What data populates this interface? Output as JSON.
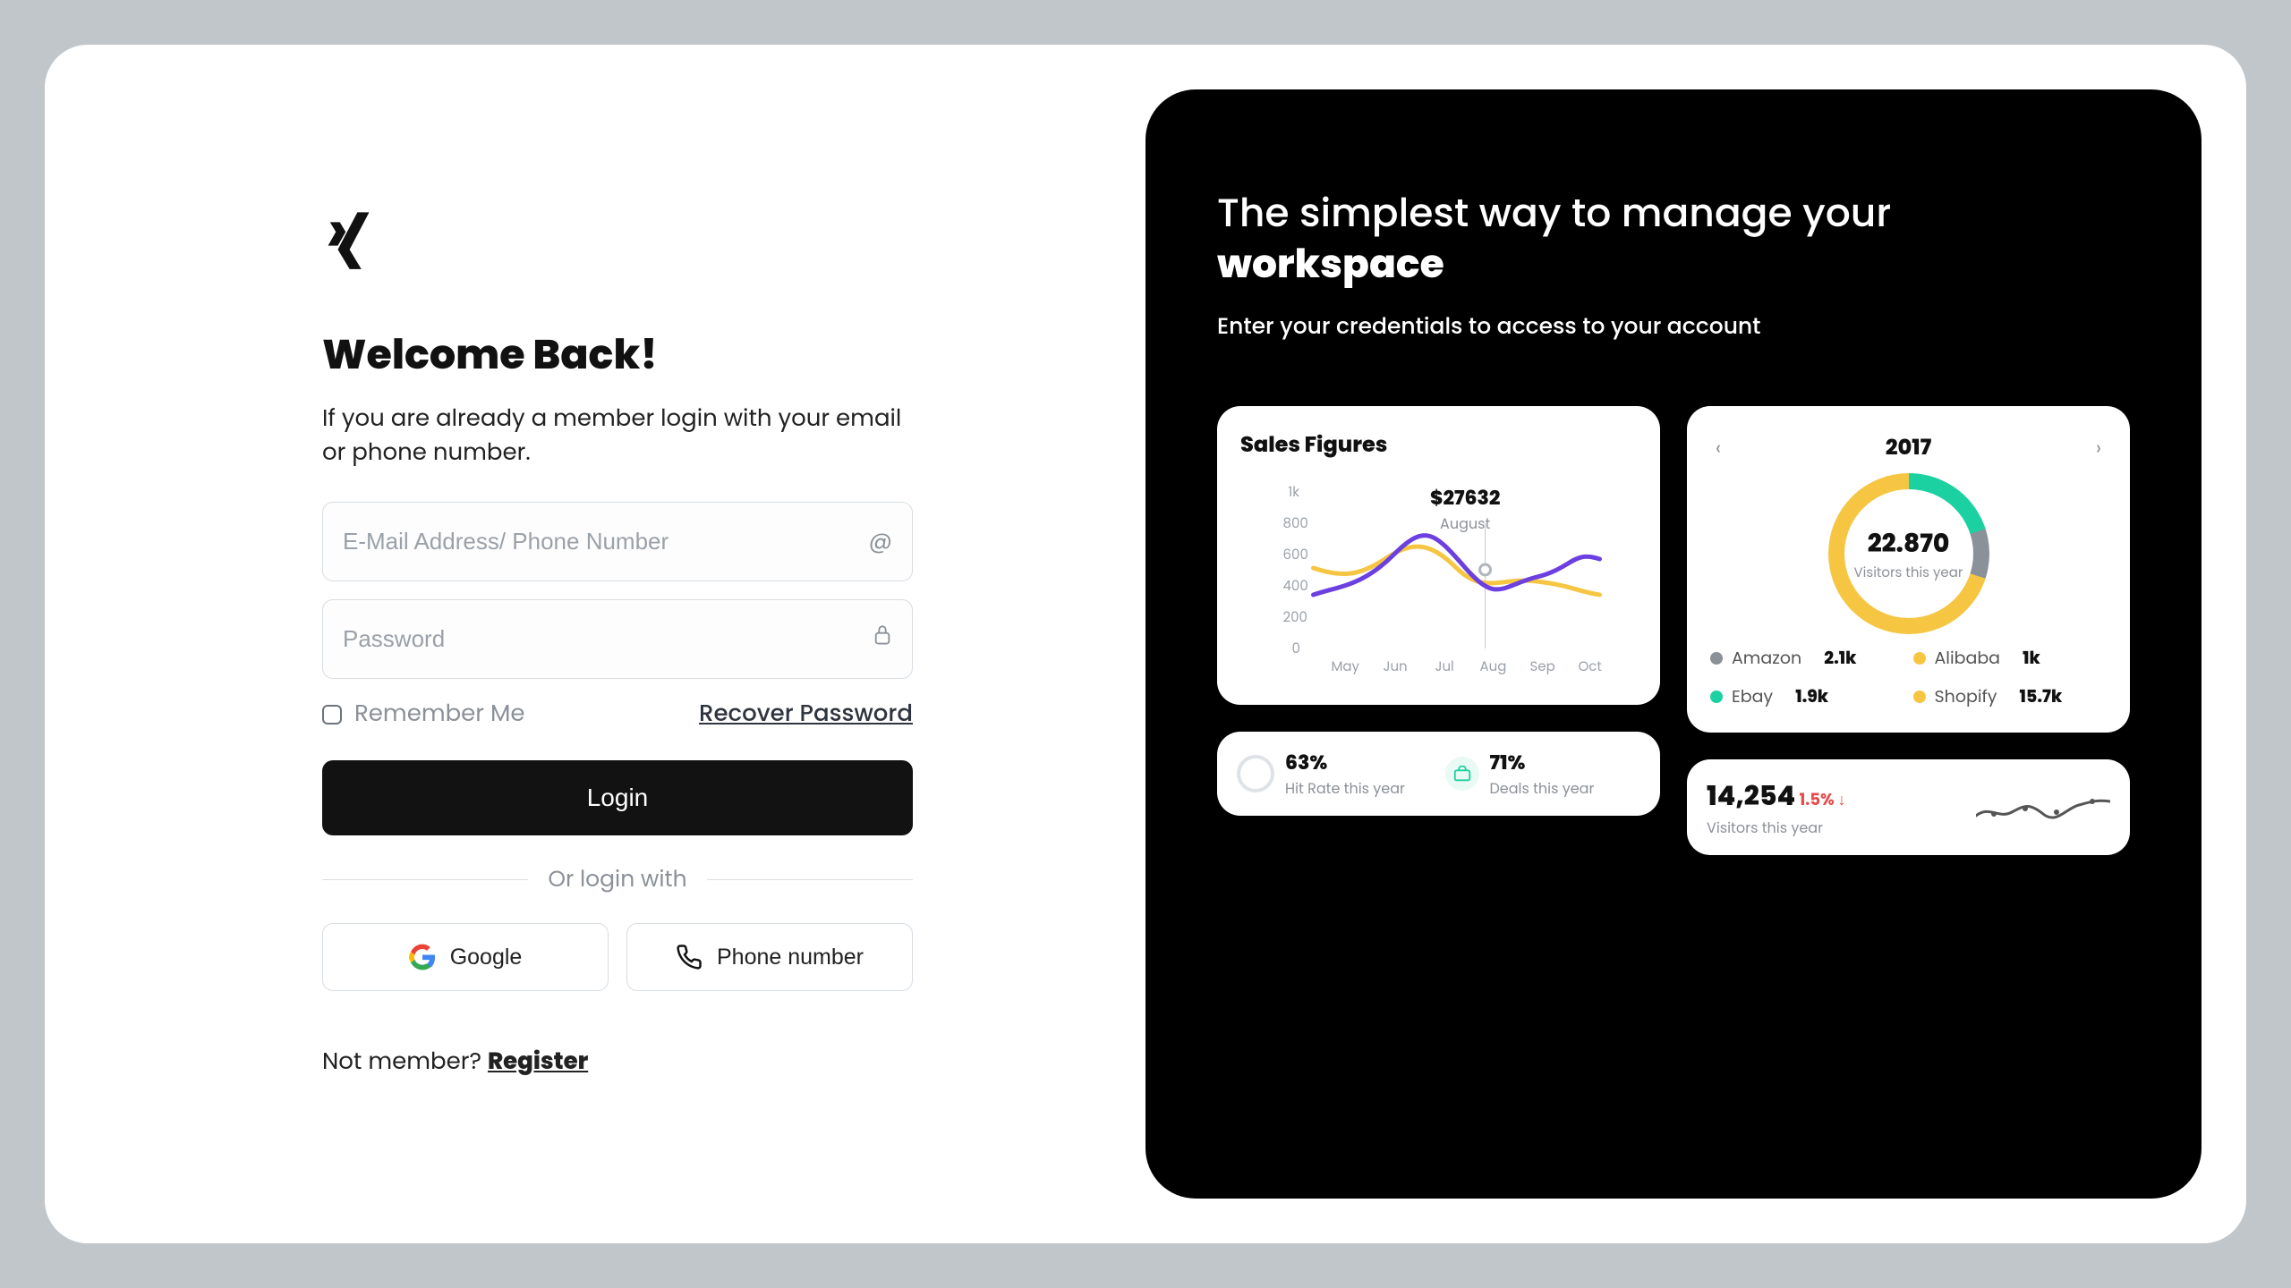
{
  "left": {
    "welcome": "Welcome Back!",
    "sub": "If you are already a member login with your email or phone number.",
    "email_placeholder": "E-Mail Address/ Phone Number",
    "password_placeholder": "Password",
    "remember": "Remember Me",
    "recover": "Recover Password",
    "login": "Login",
    "or": "Or login with",
    "google": "Google",
    "phone": "Phone number",
    "not_member": "Not member? ",
    "register": "Register"
  },
  "right": {
    "tag1": "The simplest way to manage your",
    "tag2": "workspace",
    "tagsub": "Enter your credentials to access to your account",
    "sales_title": "Sales Figures",
    "tooltip_amount": "$27632",
    "tooltip_month": "August",
    "year": "2017",
    "donut_value": "22.870",
    "donut_label": "Visitors this year",
    "legend": {
      "amazon_label": "Amazon",
      "amazon_val": "2.1k",
      "alibaba_label": "Alibaba",
      "alibaba_val": "1k",
      "ebay_label": "Ebay",
      "ebay_val": "1.9k",
      "shopify_label": "Shopify",
      "shopify_val": "15.7k"
    },
    "hit_pct": "63%",
    "hit_lbl": "Hit Rate this year",
    "deal_pct": "71%",
    "deal_lbl": "Deals this year",
    "vis_num": "14,254",
    "vis_delta": "1.5% ↓",
    "vis_lbl": "Visitors this year"
  },
  "colors": {
    "grey": "#8b9198",
    "yellow": "#f6c643",
    "teal": "#1cd1a1",
    "purple": "#6b3fe0",
    "red": "#e84b4b"
  },
  "chart_data": {
    "type": "line",
    "title": "Sales Figures",
    "xlabel": "",
    "ylabel": "",
    "ylim": [
      0,
      1000
    ],
    "yticks": [
      0,
      200,
      400,
      600,
      800,
      "1k"
    ],
    "categories": [
      "May",
      "Jun",
      "Jul",
      "Aug",
      "Sep",
      "Oct"
    ],
    "series": [
      {
        "name": "series-yellow",
        "color": "#f6c643",
        "values": [
          520,
          480,
          600,
          540,
          500,
          460
        ]
      },
      {
        "name": "series-purple",
        "color": "#6b3fe0",
        "values": [
          420,
          460,
          700,
          560,
          500,
          600
        ]
      }
    ],
    "highlight": {
      "category": "Aug",
      "value": 27632,
      "label": "August"
    }
  }
}
